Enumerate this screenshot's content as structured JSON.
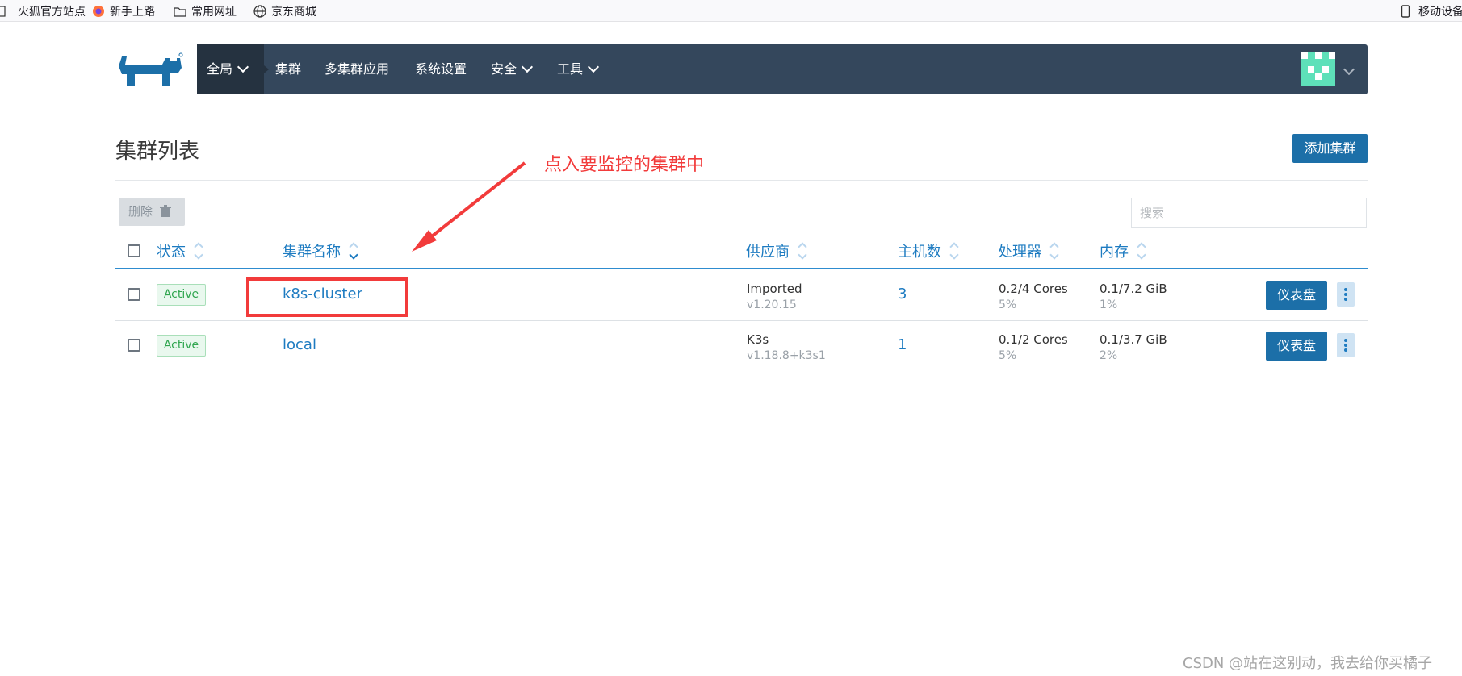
{
  "browser": {
    "bookmarks": [
      "火狐官方站点",
      "新手上路",
      "常用网址",
      "京东商城"
    ],
    "right_item": "移动设备"
  },
  "nav": {
    "global": "全局",
    "items": [
      "集群",
      "多集群应用",
      "系统设置",
      "安全",
      "工具"
    ]
  },
  "page": {
    "title": "集群列表",
    "add_button": "添加集群",
    "delete_button": "删除",
    "search_placeholder": "搜索"
  },
  "table": {
    "columns": [
      "状态",
      "集群名称",
      "供应商",
      "主机数",
      "处理器",
      "内存"
    ],
    "rows": [
      {
        "status": "Active",
        "name": "k8s-cluster",
        "provider": "Imported",
        "version": "v1.20.15",
        "hosts": "3",
        "cpu": "0.2/4 Cores",
        "cpu_pct": "5%",
        "mem": "0.1/7.2 GiB",
        "mem_pct": "1%",
        "action": "仪表盘"
      },
      {
        "status": "Active",
        "name": "local",
        "provider": "K3s",
        "version": "v1.18.8+k3s1",
        "hosts": "1",
        "cpu": "0.1/2 Cores",
        "cpu_pct": "5%",
        "mem": "0.1/3.7 GiB",
        "mem_pct": "2%",
        "action": "仪表盘"
      }
    ]
  },
  "annotation": {
    "text": "点入要监控的集群中",
    "color": "#f23b3b"
  },
  "watermark": "CSDN @站在这别动，我去给你买橘子",
  "colors": {
    "navbar": "#34475c",
    "primary": "#1c6fa8",
    "link": "#1d7bc1",
    "active": "#30a64f"
  }
}
